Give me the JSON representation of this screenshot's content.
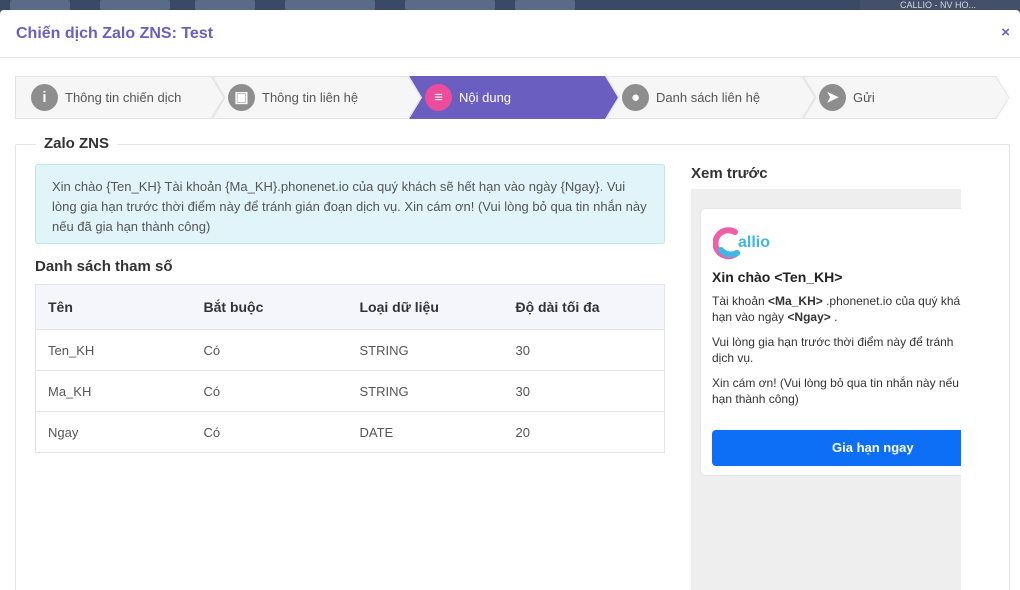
{
  "background": {
    "corner_text": "CALLIO - NV HO..."
  },
  "modal": {
    "title": "Chiến dịch Zalo ZNS: Test",
    "close_icon": "×"
  },
  "stepper": {
    "steps": [
      {
        "label": "Thông tin chiến dịch",
        "icon": "info-icon",
        "glyph": "i",
        "active": false
      },
      {
        "label": "Thông tin liên hệ",
        "icon": "contact-card-icon",
        "glyph": "▣",
        "active": false
      },
      {
        "label": "Nội dung",
        "icon": "document-icon",
        "glyph": "≡",
        "active": true
      },
      {
        "label": "Danh sách liên hệ",
        "icon": "user-icon",
        "glyph": "●",
        "active": false
      },
      {
        "label": "Gửi",
        "icon": "send-icon",
        "glyph": "➤",
        "active": false
      }
    ],
    "active_color": "#6a5fc1",
    "active_circle_color": "#ec4d9a"
  },
  "section": {
    "legend": "Zalo ZNS",
    "template_text": "Xin chào {Ten_KH} Tài khoản {Ma_KH}.phonenet.io của quý khách sẽ hết hạn vào ngày {Ngay}. Vui lòng gia hạn trước thời điểm này để tránh gián đoạn dịch vụ. Xin cám ơn! (Vui lòng bỏ qua tin nhắn này nếu đã gia hạn thành công)"
  },
  "params": {
    "title": "Danh sách tham số",
    "columns": [
      "Tên",
      "Bắt buộc",
      "Loại dữ liệu",
      "Độ dài tối đa"
    ],
    "rows": [
      [
        "Ten_KH",
        "Có",
        "STRING",
        "30"
      ],
      [
        "Ma_KH",
        "Có",
        "STRING",
        "30"
      ],
      [
        "Ngay",
        "Có",
        "DATE",
        "20"
      ]
    ]
  },
  "preview": {
    "title": "Xem trước",
    "logo_text": "allio",
    "greeting": "Xin chào <Ten_KH>",
    "line1_prefix": "Tài khoản ",
    "line1_var": "<Ma_KH>",
    "line1_suffix": " .phonenet.io của quý khá",
    "line2_prefix": "hạn vào ngày ",
    "line2_var": "<Ngay>",
    "line2_suffix": " .",
    "line3": "Vui lòng gia hạn trước thời điểm này để tránh",
    "line4": "dịch vụ.",
    "line5": "Xin cám ơn! (Vui lòng bỏ qua tin nhắn này nếu",
    "line6": "hạn thành công)",
    "button_label": "Gia hạn ngay",
    "button_color": "#0d6ef6"
  }
}
